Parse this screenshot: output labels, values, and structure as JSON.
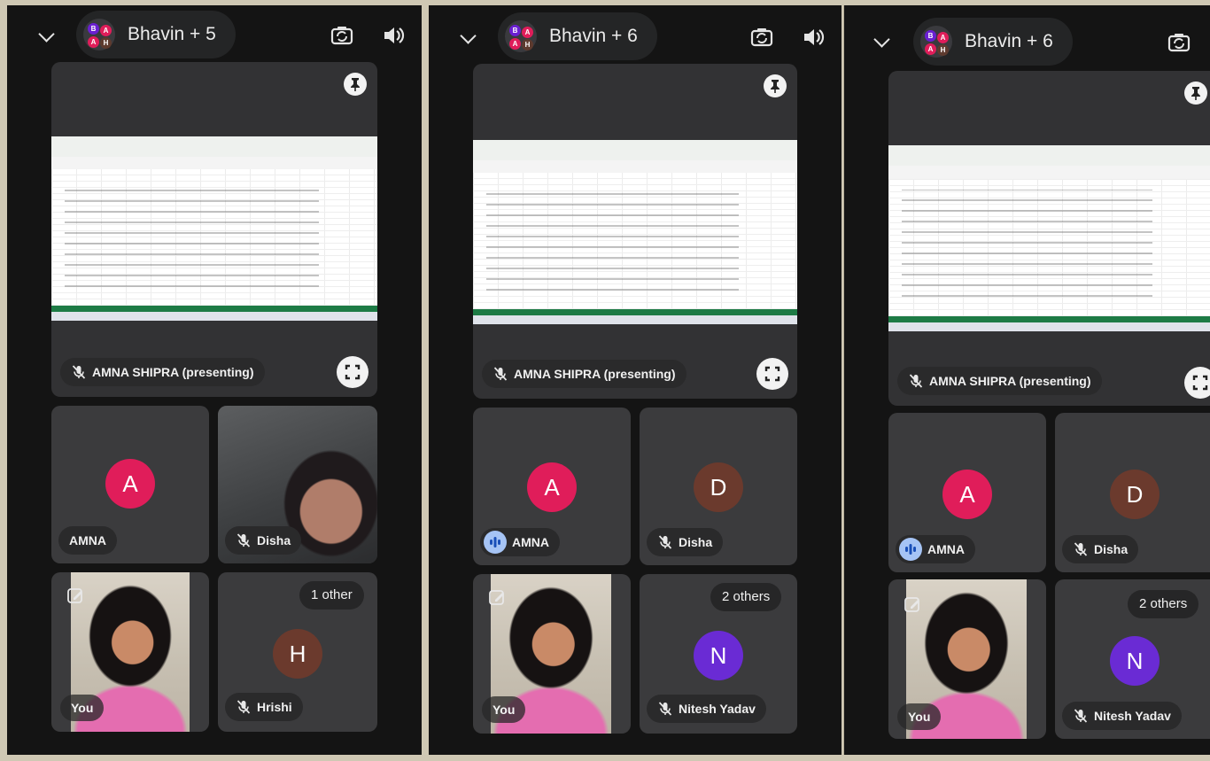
{
  "panels": [
    {
      "call_title": "Bhavin + 5",
      "presenter_chip": "AMNA SHIPRA (presenting)",
      "tiles": {
        "amna": {
          "letter": "A",
          "name": "AMNA",
          "color": "#e01d5a"
        },
        "second": {
          "type": "video",
          "name": "Disha"
        },
        "you_label": "You",
        "last": {
          "letter": "H",
          "name": "Hrishi",
          "others": "1 other",
          "color": "#6b3a2d"
        }
      }
    },
    {
      "call_title": "Bhavin + 6",
      "presenter_chip": "AMNA SHIPRA (presenting)",
      "tiles": {
        "amna": {
          "letter": "A",
          "name": "AMNA",
          "color": "#e01d5a",
          "speaking": true
        },
        "second": {
          "type": "avatar",
          "letter": "D",
          "name": "Disha",
          "color": "#6b3a2d"
        },
        "you_label": "You",
        "last": {
          "letter": "N",
          "name": "Nitesh Yadav",
          "others": "2 others",
          "color": "#6a2bd4"
        }
      }
    },
    {
      "call_title": "Bhavin + 6",
      "presenter_chip": "AMNA SHIPRA (presenting)",
      "tiles": {
        "amna": {
          "letter": "A",
          "name": "AMNA",
          "color": "#e01d5a",
          "speaking": true
        },
        "second": {
          "type": "avatar",
          "letter": "D",
          "name": "Disha",
          "color": "#6b3a2d"
        },
        "you_label": "You",
        "last": {
          "letter": "N",
          "name": "Nitesh Yadav",
          "others": "2 others",
          "color": "#6a2bd4"
        }
      }
    }
  ],
  "icons": {
    "collapse": "chevron-down-icon",
    "camera_switch": "camera-switch-icon",
    "speaker": "speaker-icon",
    "pin": "pin-icon",
    "fullscreen": "fullscreen-icon",
    "mic_off": "mic-off-icon",
    "speaking": "speaking-indicator-icon",
    "edit_background": "effects-icon"
  },
  "colors": {
    "call_background": "#141414",
    "tile_background": "#3b3b3d",
    "avatar_pink": "#e01d5a",
    "avatar_brown": "#6b3a2d",
    "avatar_purple": "#6a2bd4",
    "excel_green": "#1d7b45",
    "speaking_blue": "#a6c4f5"
  }
}
